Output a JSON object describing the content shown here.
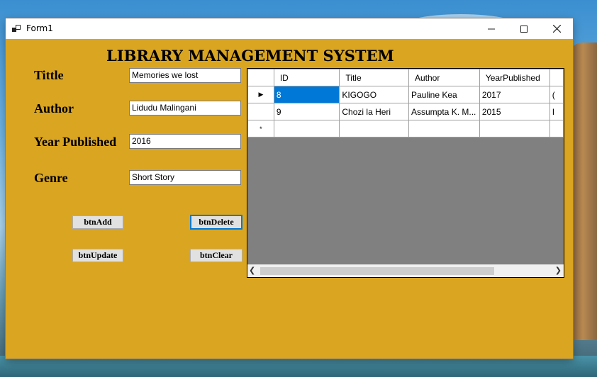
{
  "window": {
    "title": "Form1",
    "min_icon": "minimize-icon",
    "max_icon": "maximize-icon",
    "close_icon": "close-icon"
  },
  "heading": "LIBRARY MANAGEMENT SYSTEM",
  "form": {
    "title_label": "Tittle",
    "title_value": "Memories we lost",
    "author_label": "Author",
    "author_value": "Lidudu Malingani",
    "year_label": "Year Published",
    "year_value": "2016",
    "genre_label": "Genre",
    "genre_value": "Short Story"
  },
  "buttons": {
    "add": "btnAdd",
    "delete": "btnDelete",
    "update": "btnUpdate",
    "clear": "btnClear"
  },
  "grid": {
    "columns": [
      "ID",
      "Title",
      "Author",
      "YearPublished"
    ],
    "rows": [
      {
        "id": "8",
        "title": "KIGOGO",
        "author": "Pauline Kea",
        "year": "2017",
        "extra": "("
      },
      {
        "id": "9",
        "title": "Chozi la Heri",
        "author": "Assumpta K. M...",
        "year": "2015",
        "extra": "I"
      }
    ],
    "current_row_indicator": "▶",
    "new_row_indicator": "*"
  },
  "colors": {
    "form_background": "#daa520",
    "selection": "#0078d7"
  }
}
